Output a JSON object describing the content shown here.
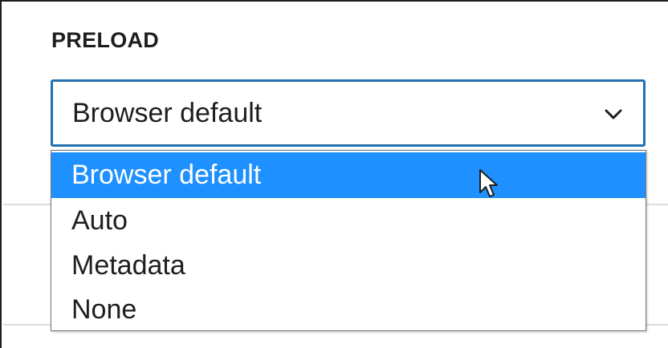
{
  "field": {
    "label": "PRELOAD",
    "selected_value": "Browser default",
    "expand_icon": "chevron-down-icon"
  },
  "dropdown": {
    "options": [
      {
        "label": "Browser default",
        "highlighted": true
      },
      {
        "label": "Auto",
        "highlighted": false
      },
      {
        "label": "Metadata",
        "highlighted": false
      },
      {
        "label": "None",
        "highlighted": false
      }
    ]
  },
  "colors": {
    "focus_border": "#2271b1",
    "highlight": "#1e90ff",
    "text": "#1e1e1e",
    "divider": "#dcdcde"
  },
  "pointer": {
    "icon": "mouse-cursor-icon"
  }
}
